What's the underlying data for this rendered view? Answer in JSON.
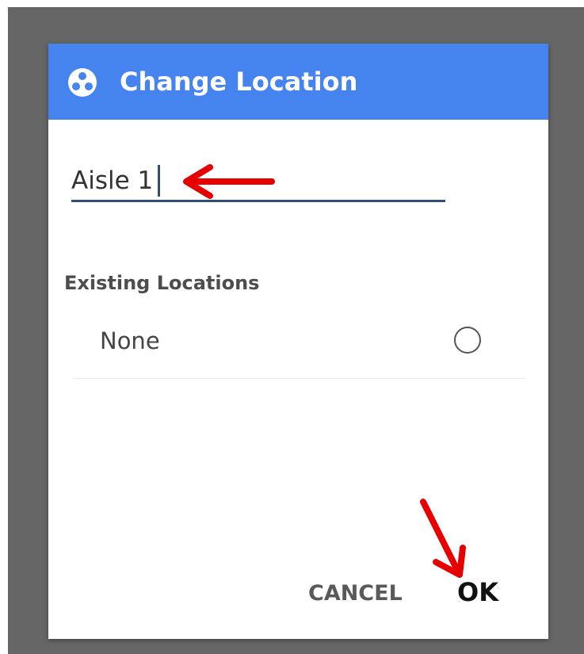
{
  "dialog": {
    "title": "Change Location",
    "title_icon": "location-pin-icon",
    "accent_color": "#4583ef"
  },
  "input": {
    "value": "Aisle 1"
  },
  "existing_locations": {
    "label": "Existing Locations",
    "items": [
      {
        "label": "None",
        "selected": false
      }
    ]
  },
  "actions": {
    "cancel_label": "CANCEL",
    "ok_label": "OK"
  },
  "annotations": {
    "arrow_color": "#e60000"
  }
}
